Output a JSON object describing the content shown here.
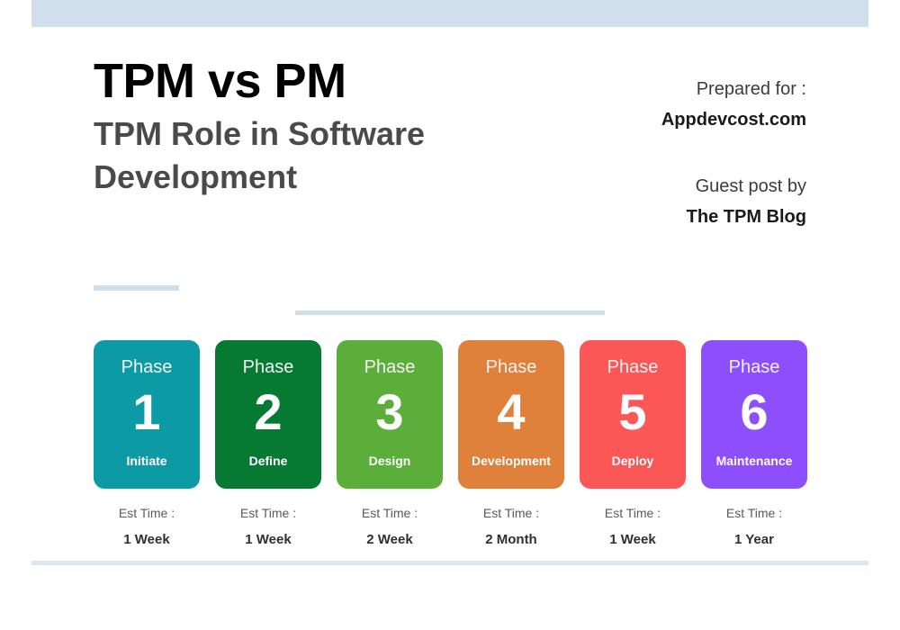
{
  "decor": {
    "top_band_color": "#cfdfec",
    "rule_color": "#cfdfec",
    "bottom_rule_color": "#dbe6f0"
  },
  "header": {
    "title": "TPM vs PM",
    "subtitle": "TPM Role in Software Development",
    "credits": [
      {
        "label": "Prepared for :",
        "value": "Appdevcost.com"
      },
      {
        "label": "Guest post by",
        "value": "The TPM Blog"
      }
    ]
  },
  "phases": {
    "phase_word": "Phase",
    "est_label": "Est Time :",
    "items": [
      {
        "number": "1",
        "name": "Initiate",
        "est_time": "1 Week",
        "color": "#0c9ba4"
      },
      {
        "number": "2",
        "name": "Define",
        "est_time": "1 Week",
        "color": "#067a33"
      },
      {
        "number": "3",
        "name": "Design",
        "est_time": "2 Week",
        "color": "#5cae3b"
      },
      {
        "number": "4",
        "name": "Development",
        "est_time": "2 Month",
        "color": "#e0813b"
      },
      {
        "number": "5",
        "name": "Deploy",
        "est_time": "1 Week",
        "color": "#fb5757"
      },
      {
        "number": "6",
        "name": "Maintenance",
        "est_time": "1 Year",
        "color": "#8c4ffb"
      }
    ]
  }
}
